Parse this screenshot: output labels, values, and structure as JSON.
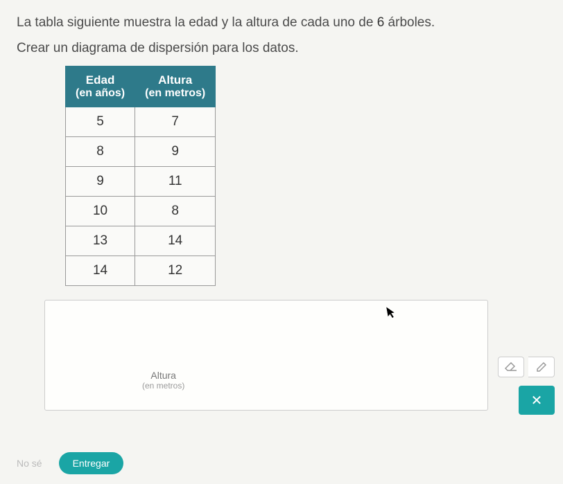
{
  "instruction1_a": "La tabla siguiente muestra la edad y la altura de cada uno de ",
  "instruction1_b": "6",
  "instruction1_c": " árboles.",
  "instruction2": "Crear un diagrama de dispersión para los datos.",
  "table": {
    "headers": {
      "col1_top": "Edad",
      "col1_sub": "(en años)",
      "col2_top": "Altura",
      "col2_sub": "(en metros)"
    },
    "rows": [
      {
        "edad": "5",
        "altura": "7"
      },
      {
        "edad": "8",
        "altura": "9"
      },
      {
        "edad": "9",
        "altura": "11"
      },
      {
        "edad": "10",
        "altura": "8"
      },
      {
        "edad": "13",
        "altura": "14"
      },
      {
        "edad": "14",
        "altura": "12"
      }
    ]
  },
  "chart": {
    "ylabel": "Altura",
    "ylabel_sub": "(en metros)"
  },
  "tools": {
    "close": "✕"
  },
  "footer": {
    "no_se": "No sé",
    "entregar": "Entregar"
  },
  "chart_data": {
    "type": "table",
    "title": "Edad vs Altura de árboles",
    "columns": [
      "Edad (en años)",
      "Altura (en metros)"
    ],
    "rows": [
      [
        5,
        7
      ],
      [
        8,
        9
      ],
      [
        9,
        11
      ],
      [
        10,
        8
      ],
      [
        13,
        14
      ],
      [
        14,
        12
      ]
    ]
  }
}
